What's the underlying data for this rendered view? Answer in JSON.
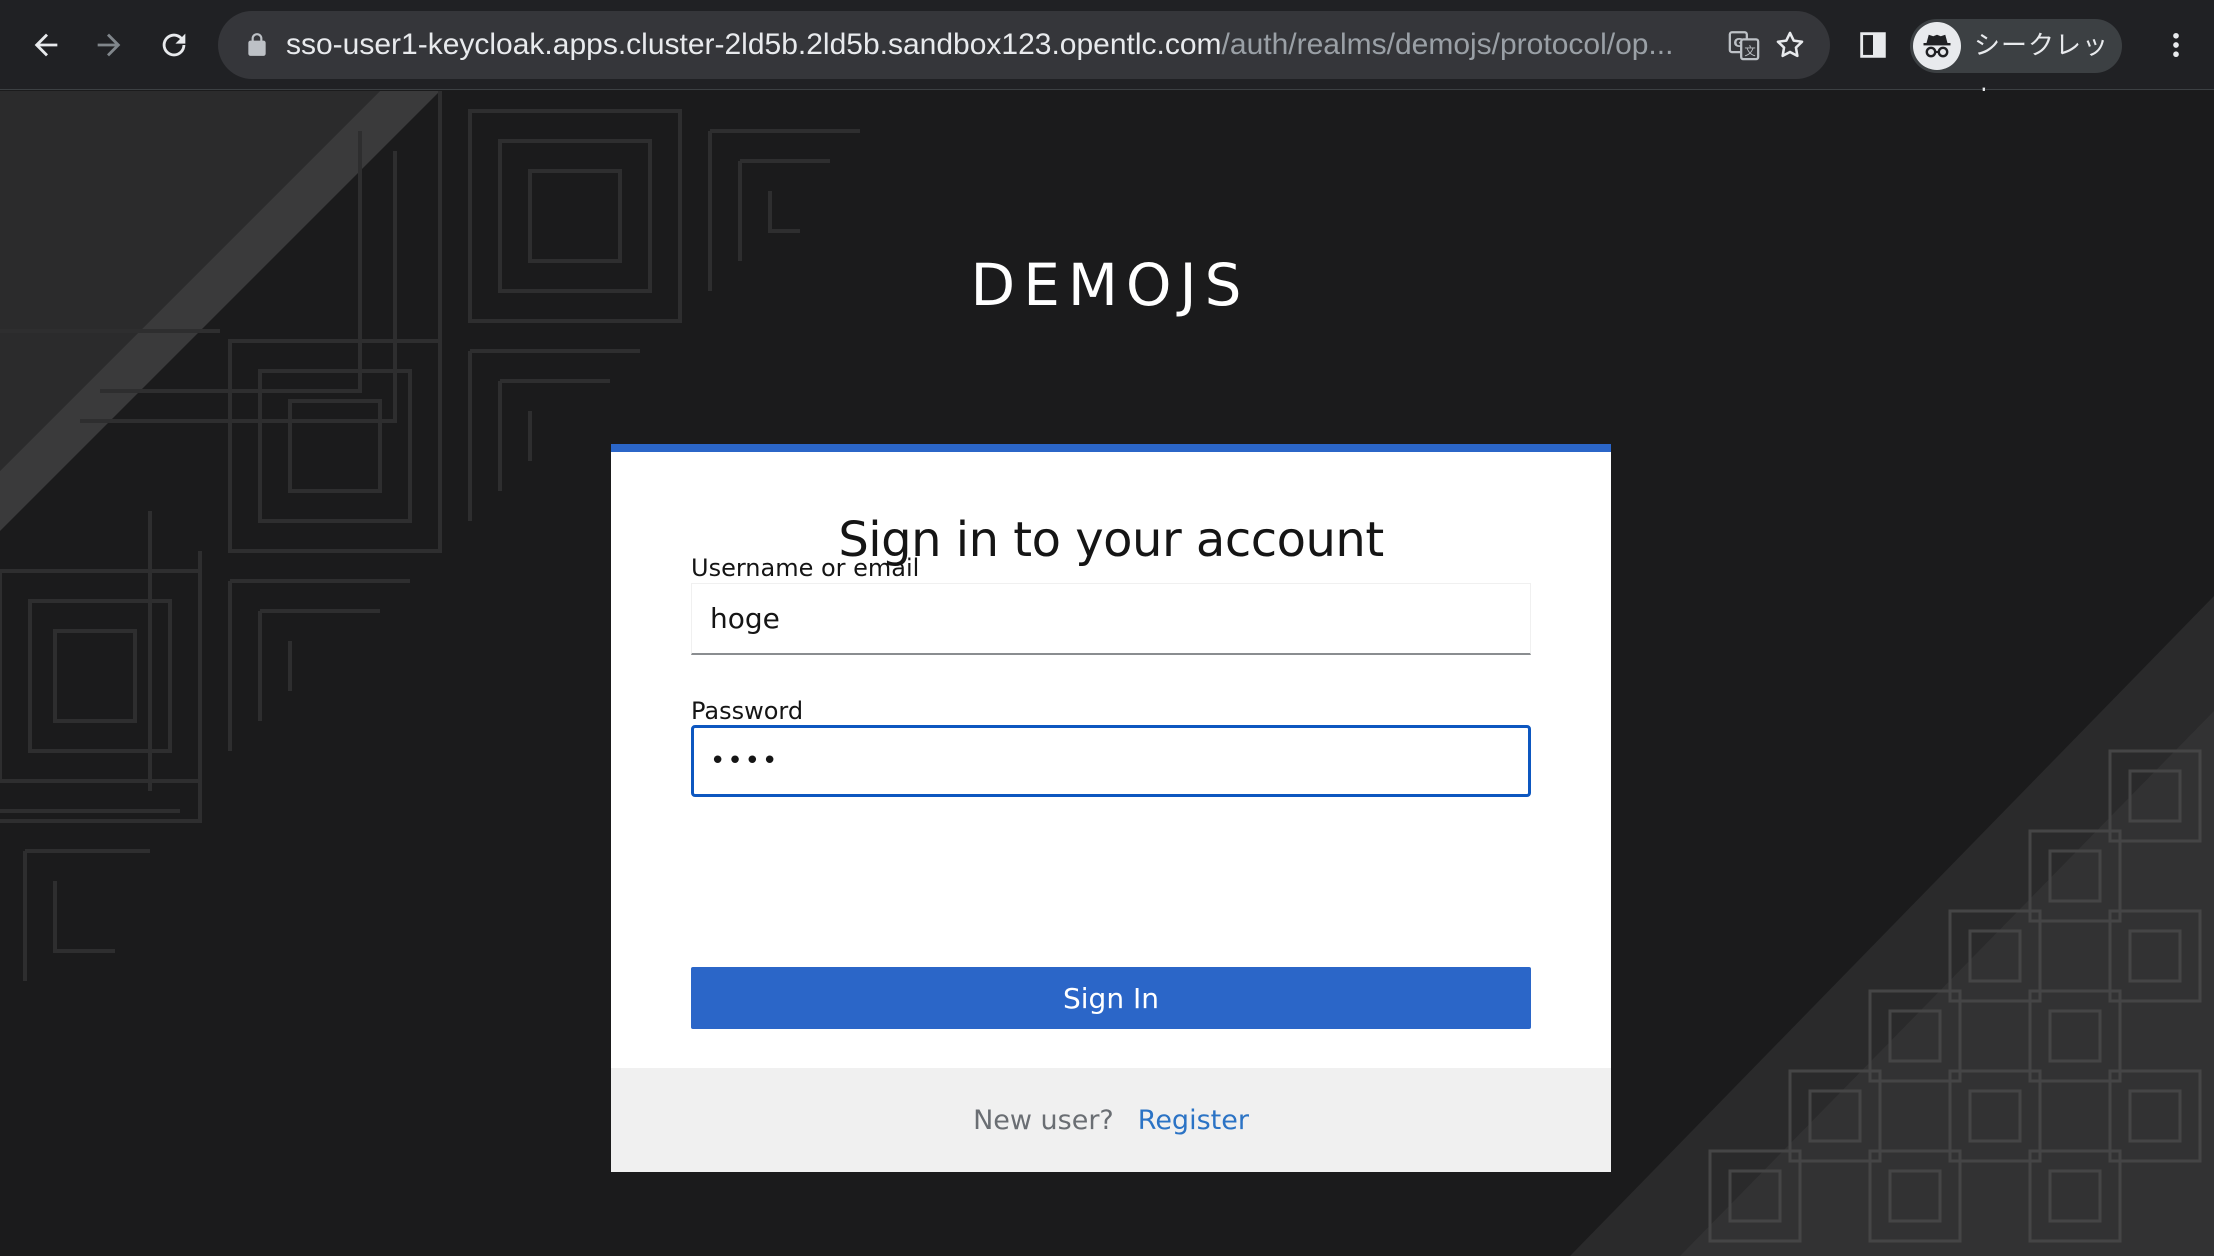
{
  "browser": {
    "url_host": "sso-user1-keycloak.apps.cluster-2ld5b.2ld5b.sandbox123.opentlc.com",
    "url_path": "/auth/realms/demojs/protocol/op...",
    "incognito_label": "シークレット",
    "icons": [
      "back-arrow-icon",
      "forward-arrow-icon",
      "reload-icon",
      "lock-icon",
      "translate-icon",
      "bookmark-star-icon",
      "side-panel-icon",
      "incognito-icon",
      "more-vert-icon"
    ]
  },
  "page": {
    "realm_name": "DEMOJS",
    "form": {
      "title": "Sign in to your account",
      "username_label": "Username or email",
      "username_value": "hoge",
      "password_label": "Password",
      "password_value": "••••",
      "submit_label": "Sign In"
    },
    "footer": {
      "new_user_text": "New user?",
      "register_link": "Register"
    }
  },
  "colors": {
    "accent": "#2b66c8",
    "background": "#1b1b1c",
    "link": "#2b73c5"
  }
}
